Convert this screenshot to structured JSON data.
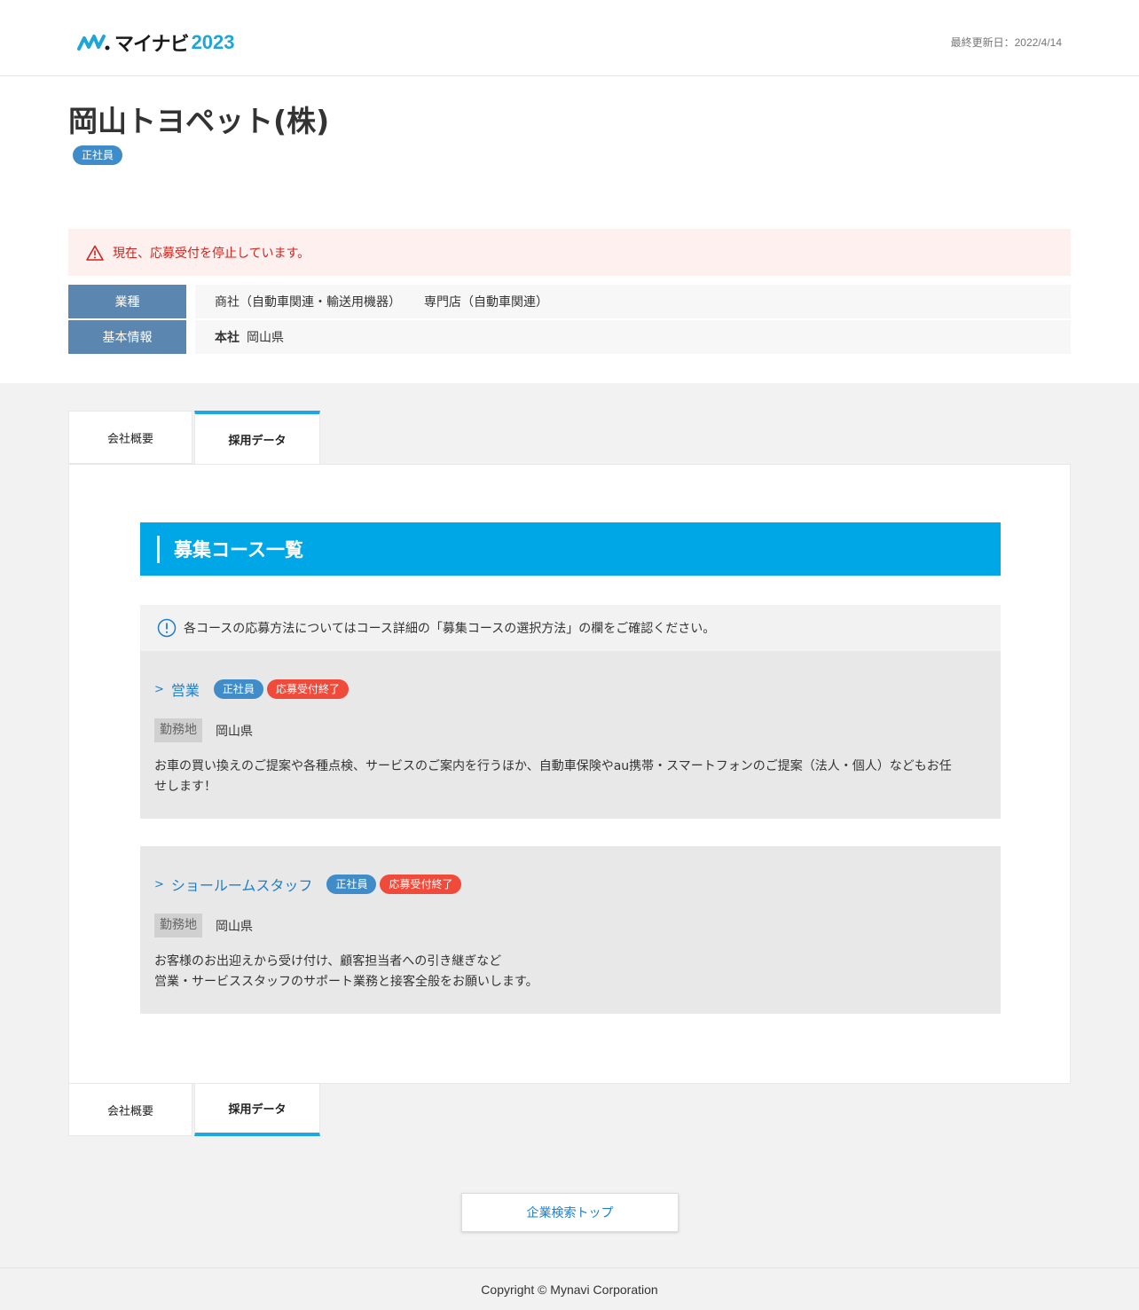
{
  "header": {
    "logo_text": "マイナビ",
    "logo_year": "2023",
    "last_updated": "最終更新日：2022/4/14"
  },
  "company": {
    "name": "岡山トヨペット(株)",
    "employment_badge": "正社員"
  },
  "alert": {
    "text": "現在、応募受付を停止しています。"
  },
  "info": {
    "industry_label": "業種",
    "industry_values": [
      "商社（自動車関連・輸送用機器）",
      "専門店（自動車関連）"
    ],
    "basic_label": "基本情報",
    "hq_label": "本社",
    "hq_value": "岡山県"
  },
  "tabs": {
    "overview": "会社概要",
    "recruit": "採用データ"
  },
  "section": {
    "title": "募集コース一覧",
    "notice": "各コースの応募方法についてはコース詳細の「募集コースの選択方法」の欄をご確認ください。"
  },
  "courses": [
    {
      "title": "営業",
      "badge_type": "正社員",
      "badge_status": "応募受付終了",
      "location_label": "勤務地",
      "location": "岡山県",
      "description": "お車の買い換えのご提案や各種点検、サービスのご案内を行うほか、自動車保険やau携帯・スマートフォンのご提案（法人・個人）などもお任\nせします！"
    },
    {
      "title": "ショールームスタッフ",
      "badge_type": "正社員",
      "badge_status": "応募受付終了",
      "location_label": "勤務地",
      "location": "岡山県",
      "description": "お客様のお出迎えから受け付け、顧客担当者への引き継ぎなど\n営業・サービススタッフのサポート業務と接客全般をお願いします。"
    }
  ],
  "back_button": "企業検索トップ",
  "footer": "Copyright © Mynavi Corporation",
  "colors": {
    "accent": "#00a7e6",
    "badge_blue": "#3f8cc9",
    "badge_red": "#f04a3a",
    "alert_red": "#d2221a",
    "label_blue": "#5b86b0",
    "link_blue": "#1e7fc8"
  }
}
